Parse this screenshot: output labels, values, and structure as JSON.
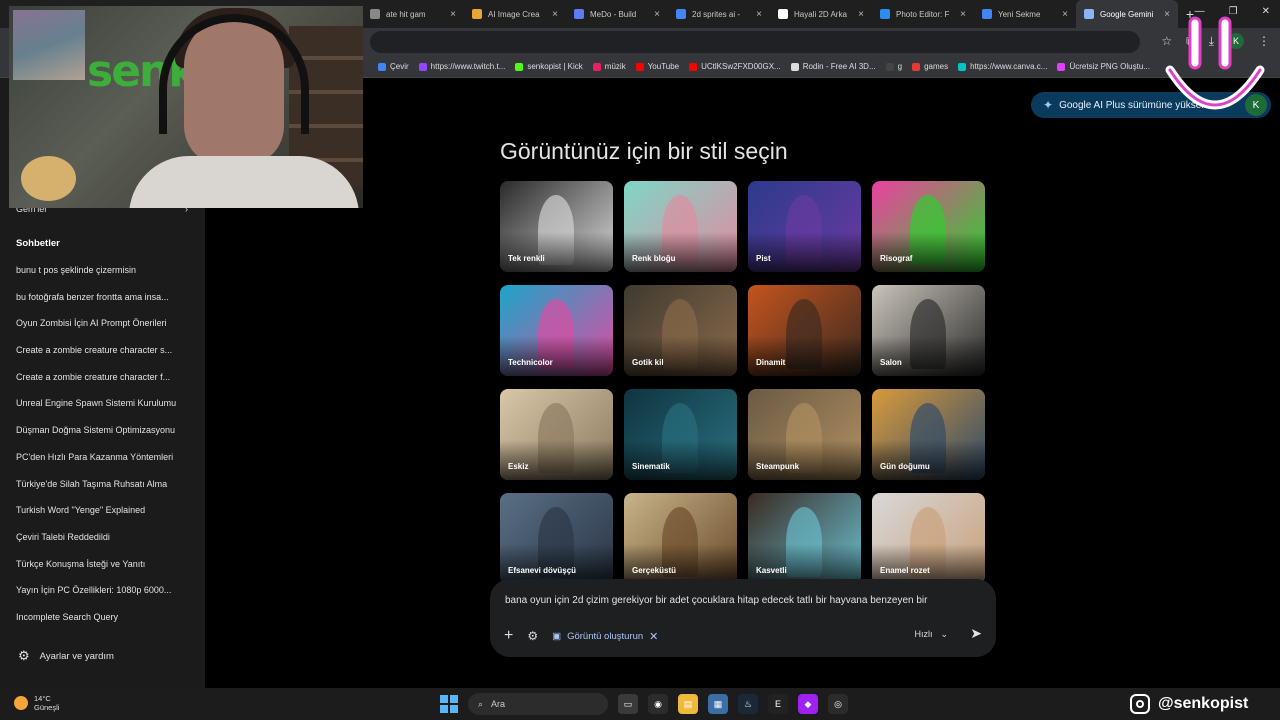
{
  "browser": {
    "tabs": [
      {
        "title": "ate hit gam",
        "favicon_color": "#888888"
      },
      {
        "title": "AI Image Crea",
        "favicon_color": "#e6a832"
      },
      {
        "title": "MeDo - Build",
        "favicon_color": "#5b7cf5"
      },
      {
        "title": "2d sprites ai -",
        "favicon_color": "#4285f4"
      },
      {
        "title": "Hayali 2D Arka",
        "favicon_color": "#ffffff"
      },
      {
        "title": "Photo Editor: F",
        "favicon_color": "#2d8cf0"
      },
      {
        "title": "Yeni Sekme",
        "favicon_color": "#4285f4"
      },
      {
        "title": "Google Gemini",
        "favicon_color": "#8ab4f8",
        "active": true
      }
    ],
    "tab_close": "×",
    "new_tab": "+",
    "window_controls": [
      "—",
      "❐",
      "✕"
    ],
    "profile_initial": "K",
    "bookmarks": [
      {
        "label": "Çevir",
        "color": "#4285f4"
      },
      {
        "label": "https://www.twitch.t...",
        "color": "#9146ff"
      },
      {
        "label": "senkopist | Kick",
        "color": "#53fc18"
      },
      {
        "label": "müzik",
        "color": "#e91e63"
      },
      {
        "label": "YouTube",
        "color": "#ff0000"
      },
      {
        "label": "UCtlKSw2FXD00GX...",
        "color": "#ff0000"
      },
      {
        "label": "Rodin - Free AI 3D...",
        "color": "#dddddd"
      },
      {
        "label": "g",
        "color": "#444444"
      },
      {
        "label": "games",
        "color": "#e53935"
      },
      {
        "label": "https://www.canva.c...",
        "color": "#00c4cc"
      },
      {
        "label": "Ücretsiz PNG Oluştu...",
        "color": "#e040fb"
      }
    ]
  },
  "sidebar": {
    "gems_label": "Gem'ler",
    "gems_chevron": "›",
    "chats_heading": "Sohbetler",
    "chats": [
      "bunu t pos şeklinde çizermisin",
      "bu fotoğrafa benzer frontta ama insa...",
      "Oyun Zombisi İçin AI Prompt Önerileri",
      "Create a zombie creature character s...",
      "Create a zombie creature character f...",
      "Unreal Engine Spawn Sistemi Kurulumu",
      "Düşman Doğma Sistemi Optimizasyonu",
      "PC'den Hızlı Para Kazanma Yöntemleri",
      "Türkiye'de Silah Taşıma Ruhsatı Alma",
      "Turkish Word \"Yenge\" Explained",
      "Çeviri Talebi Reddedildi",
      "Türkçe Konuşma İsteği ve Yanıtı",
      "Yayın İçin PC Özellikleri: 1080p 6000...",
      "Incomplete Search Query"
    ],
    "settings_label": "Ayarlar ve yardım"
  },
  "main": {
    "upgrade_label": "Google AI Plus sürümüne yükseltin",
    "avatar_initial": "K",
    "heading": "Görüntünüz için bir stil seçin",
    "styles": [
      {
        "label": "Tek renkli",
        "bg": "#2a2a2a",
        "accent": "#d8d8d8"
      },
      {
        "label": "Renk bloğu",
        "bg": "#7fd6c6",
        "accent": "#e28aa0"
      },
      {
        "label": "Pist",
        "bg": "#2d3a8c",
        "accent": "#6a3aa0"
      },
      {
        "label": "Risograf",
        "bg": "#ee3fa0",
        "accent": "#2bd12b"
      },
      {
        "label": "Technicolor",
        "bg": "#1aa6c8",
        "accent": "#e24aa0"
      },
      {
        "label": "Gotik kil",
        "bg": "#3f3a30",
        "accent": "#8b6a4a"
      },
      {
        "label": "Dinamit",
        "bg": "#c4541d",
        "accent": "#3a2a20"
      },
      {
        "label": "Salon",
        "bg": "#c9c4bb",
        "accent": "#2b2b2b"
      },
      {
        "label": "Eskiz",
        "bg": "#d9c7a8",
        "accent": "#8a7a60"
      },
      {
        "label": "Sinematik",
        "bg": "#0f3440",
        "accent": "#2a7080"
      },
      {
        "label": "Steampunk",
        "bg": "#6b5a45",
        "accent": "#b09060"
      },
      {
        "label": "Gün doğumu",
        "bg": "#d99a3c",
        "accent": "#2d4a6a"
      },
      {
        "label": "Efsanevi dövüşçü",
        "bg": "#5a6f85",
        "accent": "#2a3545"
      },
      {
        "label": "Gerçeküstü",
        "bg": "#c8b48a",
        "accent": "#6a4a2a"
      },
      {
        "label": "Kasvetli",
        "bg": "#3a2a22",
        "accent": "#6ac0d0"
      },
      {
        "label": "Enamel rozet",
        "bg": "#d8d8d8",
        "accent": "#c9a07a"
      }
    ],
    "prompt": {
      "text": "bana oyun için 2d çizim gerekiyor bir adet çocuklara hitap edecek tatlı bir hayvana benzeyen bir",
      "plus": "+",
      "tools_icon": "⚙",
      "chip_label": "Görüntü oluşturun",
      "chip_close": "✕",
      "model_label": "Hızlı",
      "model_chevron": "⌄",
      "send": "➤"
    }
  },
  "taskbar": {
    "temperature": "14°C",
    "weather": "Güneşli",
    "search_placeholder": "Ara",
    "instagram_handle": "@senkopist"
  },
  "stream": {
    "graffiti_text": "senk"
  }
}
